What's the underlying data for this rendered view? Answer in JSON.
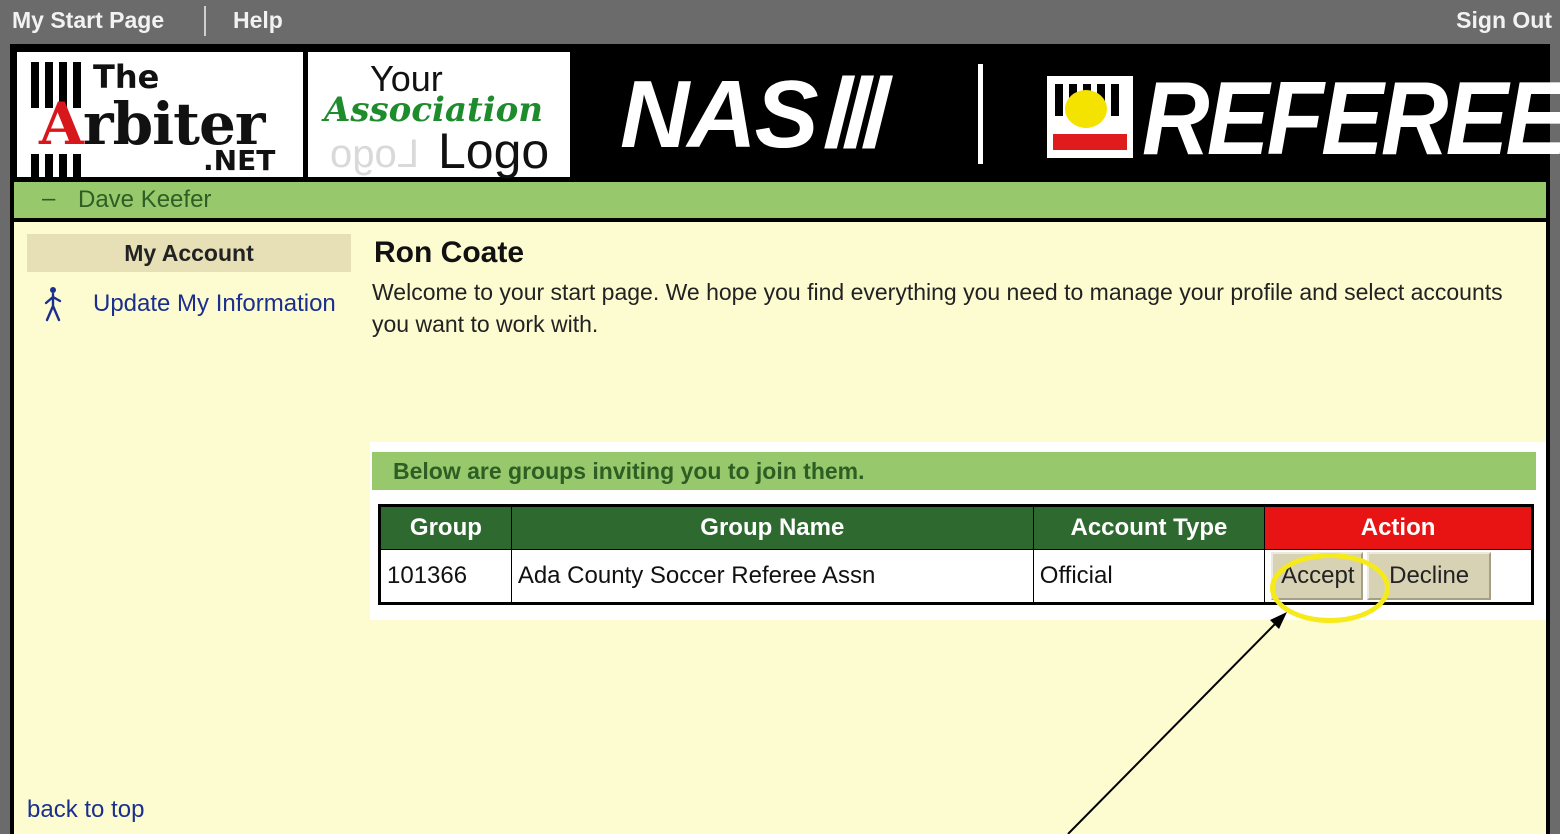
{
  "topnav": {
    "start_page": "My Start Page",
    "help": "Help",
    "sign_out": "Sign Out"
  },
  "banner": {
    "arbiter": {
      "the": "The",
      "word_first": "A",
      "word_rest": "rbiter",
      "net": ".NET"
    },
    "association_logo": {
      "your": "Your",
      "association": "Association",
      "logo": "Logo",
      "mirror": "Logo"
    },
    "naso": "NASⅢ",
    "referee": "REFEREE"
  },
  "userbar": {
    "toggle": "–",
    "name": "Dave Keefer"
  },
  "sidebar": {
    "header": "My Account",
    "update_link": "Update My Information",
    "back_to_top": "back to top",
    "icon": "walking-person-icon"
  },
  "main": {
    "title": "Ron Coate",
    "welcome": "Welcome to your start page. We hope you find everything you need to manage your profile and select accounts you want to work with.",
    "invite_heading": "Below are groups inviting you to join them.",
    "table": {
      "headers": [
        "Group",
        "Group Name",
        "Account Type",
        "Action"
      ],
      "rows": [
        {
          "group": "101366",
          "group_name": "Ada County Soccer Referee Assn",
          "account_type": "Official",
          "accept": "Accept",
          "decline": "Decline"
        }
      ]
    }
  },
  "colors": {
    "green_bar": "#98c86c",
    "header_green": "#2e6a30",
    "action_red": "#e81414",
    "content_bg": "#fdfbd0",
    "highlight": "#f6ea1a"
  }
}
